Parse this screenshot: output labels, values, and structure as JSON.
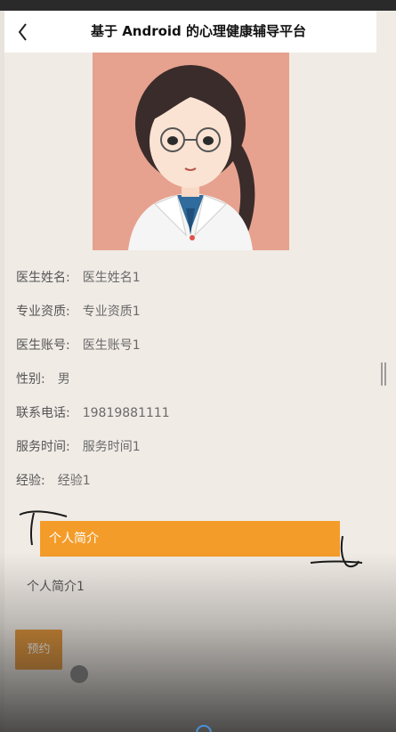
{
  "header": {
    "title": "基于 Android 的心理健康辅导平台",
    "back_icon": "chevron-left-icon"
  },
  "doctor": {
    "portrait_icon": "doctor-portrait",
    "fields": [
      {
        "label": "医生姓名:",
        "value": "医生姓名1"
      },
      {
        "label": "专业资质:",
        "value": "专业资质1"
      },
      {
        "label": "医生账号:",
        "value": "医生账号1"
      },
      {
        "label": "性别:",
        "value": "男"
      },
      {
        "label": "联系电话:",
        "value": "19819881111"
      },
      {
        "label": "服务时间:",
        "value": "服务时间1"
      },
      {
        "label": "经验:",
        "value": "经验1"
      }
    ]
  },
  "intro": {
    "heading": "个人简介",
    "text": "个人简介1"
  },
  "actions": {
    "book_label": "预约"
  },
  "colors": {
    "accent": "#f49c2a",
    "button": "#e09236",
    "page_bg": "#f0ebe5",
    "portrait_bg": "#e6a28f"
  }
}
